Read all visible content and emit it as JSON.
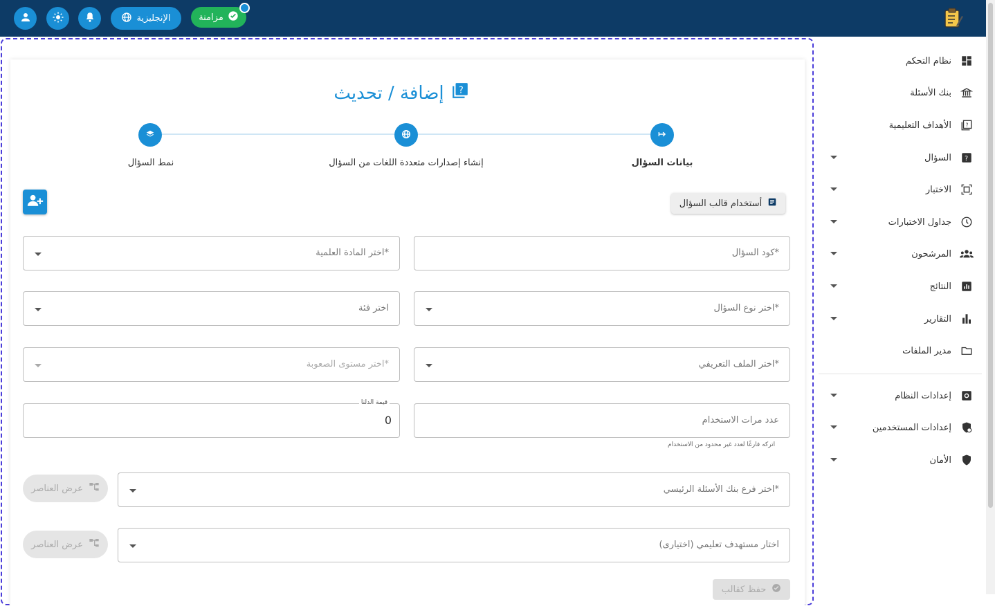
{
  "header": {
    "sync_label": "مزامنة",
    "language_label": "الإنجليزية",
    "colors": {
      "bar": "#0d3b66",
      "accent": "#1a8fd6",
      "sync": "#22b35a"
    }
  },
  "sidebar": {
    "items": [
      {
        "label": "نظام التحكم",
        "icon": "dashboard-icon",
        "has_caret": false
      },
      {
        "label": "بنك الأسئلة",
        "icon": "bank-icon",
        "has_caret": false
      },
      {
        "label": "الأهداف التعليمية",
        "icon": "objectives-icon",
        "has_caret": false
      },
      {
        "label": "السؤال",
        "icon": "question-icon",
        "has_caret": true
      },
      {
        "label": "الاختبار",
        "icon": "exam-icon",
        "has_caret": true
      },
      {
        "label": "جداول الاختبارات",
        "icon": "clock-icon",
        "has_caret": true
      },
      {
        "label": "المرشحون",
        "icon": "group-icon",
        "has_caret": true
      },
      {
        "label": "النتائج",
        "icon": "results-icon",
        "has_caret": true
      },
      {
        "label": "التقارير",
        "icon": "reports-icon",
        "has_caret": true
      },
      {
        "label": "مدير الملفات",
        "icon": "folder-icon",
        "has_caret": false
      },
      {
        "label": "إعدادات النظام",
        "icon": "settings-icon",
        "has_caret": true
      },
      {
        "label": "إعدادات المستخدمين",
        "icon": "user-settings-icon",
        "has_caret": true
      },
      {
        "label": "الأمان",
        "icon": "shield-icon",
        "has_caret": true
      }
    ]
  },
  "page": {
    "title": "إضافة / تحديث",
    "steps": [
      {
        "label": "بيانات السؤال",
        "active": true
      },
      {
        "label": "إنشاء إصدارات متعددة اللغات من السؤال",
        "active": false
      },
      {
        "label": "نمط السؤال",
        "active": false
      }
    ],
    "template_button": "أستخدام قالب السؤال",
    "fields": {
      "question_code": "كود السؤال*",
      "subject": "اختر المادة العلمية*",
      "question_type": "اختر نوع السؤال*",
      "category": "اختر فئة",
      "profile": "اختر الملف التعريفي*",
      "difficulty": "اختر مستوى الصعوبة*",
      "usage_count": "عدد مرات الاستخدام",
      "delta_label": "قيمة الدلتا",
      "delta_value": "0",
      "usage_hint": "اتركه فارغًا لعدد غير محدود من الاستخدام",
      "bank_branch": "اختر فرع بنك الأسئلة الرئيسي*",
      "learning_target": "اختار مستهدف تعليمي (اختيارى)"
    },
    "view_elements_button": "عرض العناصر",
    "save_template_button": "حفظ كقالب"
  }
}
